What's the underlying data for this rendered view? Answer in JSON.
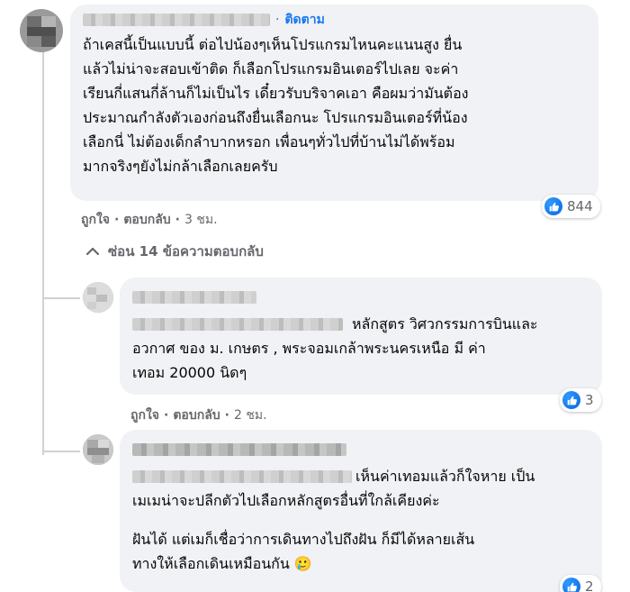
{
  "comment": {
    "follow_label": "ติดตาม",
    "lines": [
      "ถ้าเคสนี้เป็นแบบนี้ ต่อไปน้องๆเห็นโปรแกรมไหนคะแนนสูง ยื่น",
      "แล้วไม่น่าจะสอบเข้าติด ก็เลือกโปรแกรมอินเตอร์ไปเลย จะค่า",
      "เรียนกี่แสนกี่ล้านก็ไม่เป็นไร เดี๋ยวรับบริจาคเอา คือผมว่ามันต้อง",
      "ประมาณกำลังตัวเองก่อนถึงยื่นเลือกนะ โปรแกรมอินเตอร์ที่น้อง",
      "เลือกนี่ ไม่ต้องเด็กลำบากหรอก เพื่อนๆทั่วไปที่บ้านไม่ได้พร้อม",
      "มากจริงๆยังไม่กล้าเลือกเลยครับ"
    ],
    "reaction_count": "844",
    "like_label": "ถูกใจ",
    "reply_label": "ตอบกลับ",
    "time": "3 ชม.",
    "hide_replies_label": "ซ่อน 14 ข้อความตอบกลับ"
  },
  "reply1": {
    "lines": [
      "หลักสูตร วิศวกรรมการบินและ",
      "อวกาศ ของ ม. เกษตร , พระจอมเกล้าพระนครเหนือ มี ค่า",
      "เทอม 20000 นิดๆ"
    ],
    "reaction_count": "3",
    "like_label": "ถูกใจ",
    "reply_label": "ตอบกลับ",
    "time": "2 ชม."
  },
  "reply2": {
    "lines": [
      "เห็นค่าเทอมแล้วก็ใจหาย เป็น",
      "เมเมน่าจะปลีกตัวไปเลือกหลักสูตรอื่นที่ใกล้เคียงค่ะ",
      "ฝันได้ แต่เมก็เชื่อว่าการเดินทางไปถึงฝัน ก็มีได้หลายเส้น",
      "ทางให้เลือกเดินเหมือนกัน 🥲"
    ],
    "reaction_count": "2"
  },
  "separator": "·",
  "colors": {
    "accent": "#1877f2",
    "bubble": "#f0f2f5",
    "meta": "#65676b"
  }
}
